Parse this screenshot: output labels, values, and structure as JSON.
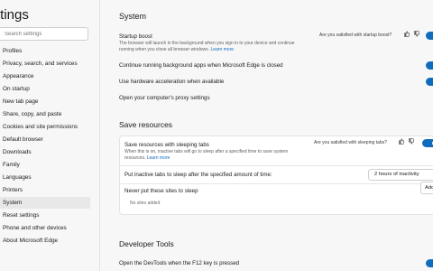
{
  "sidebar": {
    "title": "ttings",
    "search_placeholder": "Search settings",
    "items": [
      {
        "label": "Profiles"
      },
      {
        "label": "Privacy, search, and services"
      },
      {
        "label": "Appearance"
      },
      {
        "label": "On startup"
      },
      {
        "label": "New tab page"
      },
      {
        "label": "Share, copy, and paste"
      },
      {
        "label": "Cookies and site permissions"
      },
      {
        "label": "Default browser"
      },
      {
        "label": "Downloads"
      },
      {
        "label": "Family"
      },
      {
        "label": "Languages"
      },
      {
        "label": "Printers"
      },
      {
        "label": "System"
      },
      {
        "label": "Reset settings"
      },
      {
        "label": "Phone and other devices"
      },
      {
        "label": "About Microsoft Edge"
      }
    ],
    "active_item": "System"
  },
  "system": {
    "heading": "System",
    "startup_boost": {
      "title": "Startup boost",
      "description": "The browser will launch in the background when you sign in to your device and continue running when you close all browser windows.",
      "learn_more": "Learn more",
      "feedback": "Are you satisfied with startup boost?",
      "enabled": true
    },
    "background_apps": {
      "title": "Continue running background apps when Microsoft Edge is closed",
      "enabled": true
    },
    "hardware_accel": {
      "title": "Use hardware acceleration when available",
      "enabled": true
    },
    "proxy": {
      "title": "Open your computer's proxy settings"
    }
  },
  "save_resources": {
    "heading": "Save resources",
    "sleeping_tabs": {
      "title": "Save resources with sleeping tabs",
      "description": "When this is on, inactive tabs will go to sleep after a specified time to save system resources.",
      "learn_more": "Learn more",
      "feedback": "Are you satisfied with sleeping tabs?",
      "enabled": true
    },
    "inactive_sleep": {
      "title": "Put inactive tabs to sleep after the specified amount of time:",
      "value": "2 hours of inactivity"
    },
    "never_sleep": {
      "title": "Never put these sites to sleep",
      "add_label": "Add",
      "empty_text": "No sites added"
    }
  },
  "developer_tools": {
    "heading": "Developer Tools",
    "f12": {
      "title": "Open the DevTools when the F12 key is pressed",
      "enabled": true
    }
  },
  "colors": {
    "accent": "#0f6cbd"
  }
}
